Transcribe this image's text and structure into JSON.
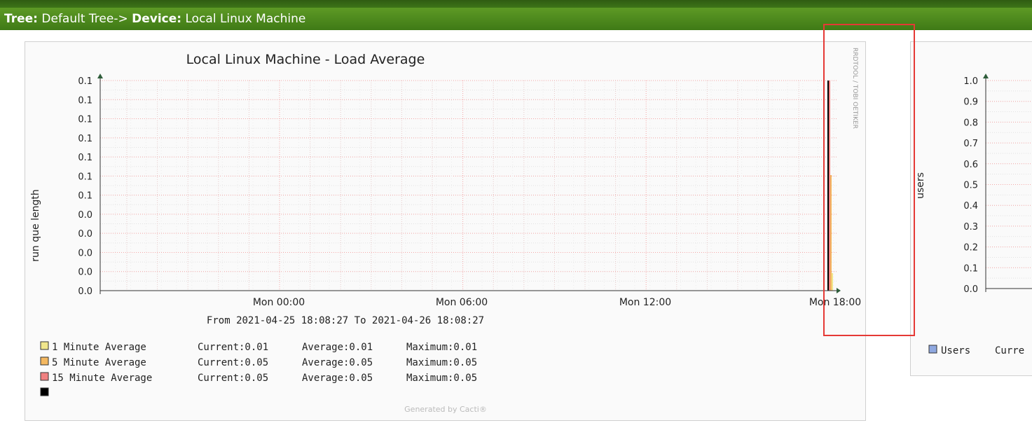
{
  "breadcrumb": {
    "tree_label": "Tree:",
    "tree_value": "Default Tree->",
    "device_label": "Device:",
    "device_value": "Local Linux Machine"
  },
  "graph_left": {
    "title": "Local Linux Machine - Load Average",
    "ylabel": "run que length",
    "watermark": "RRDTOOL / TOBI OETIKER",
    "y_ticks": [
      "0.1",
      "0.1",
      "0.1",
      "0.1",
      "0.1",
      "0.1",
      "0.1",
      "0.0",
      "0.0",
      "0.0",
      "0.0",
      "0.0"
    ],
    "x_ticks": [
      "Mon 00:00",
      "Mon 06:00",
      "Mon 12:00",
      "Mon 18:00"
    ],
    "range_text": "From 2021-04-25 18:08:27 To 2021-04-26 18:08:27",
    "legend": [
      {
        "name": "1 Minute Average",
        "current": "Current:0.01",
        "average": "Average:0.01",
        "maximum": "Maximum:0.01",
        "color": "#f0e68c"
      },
      {
        "name": "5 Minute Average",
        "current": "Current:0.05",
        "average": "Average:0.05",
        "maximum": "Maximum:0.05",
        "color": "#f4b860"
      },
      {
        "name": "15 Minute Average",
        "current": "Current:0.05",
        "average": "Average:0.05",
        "maximum": "Maximum:0.05",
        "color": "#f08080"
      },
      {
        "name": "",
        "current": "",
        "average": "",
        "maximum": "",
        "color": "#000000"
      }
    ],
    "footer": "Generated by Cacti®"
  },
  "graph_right": {
    "ylabel": "users",
    "y_ticks": [
      "1.0",
      "0.9",
      "0.8",
      "0.7",
      "0.6",
      "0.5",
      "0.4",
      "0.3",
      "0.2",
      "0.1",
      "0.0"
    ],
    "legend": [
      {
        "name": "Users",
        "current": "Curre",
        "color": "#8fa8e0"
      }
    ]
  },
  "chart_data": [
    {
      "type": "area",
      "title": "Local Linux Machine - Load Average",
      "xlabel": "",
      "ylabel": "run que length",
      "x_range": [
        "2021-04-25 18:08:27",
        "2021-04-26 18:08:27"
      ],
      "series": [
        {
          "name": "1 Minute Average",
          "current": 0.01,
          "average": 0.01,
          "maximum": 0.01
        },
        {
          "name": "5 Minute Average",
          "current": 0.05,
          "average": 0.05,
          "maximum": 0.05
        },
        {
          "name": "15 Minute Average",
          "current": 0.05,
          "average": 0.05,
          "maximum": 0.05
        }
      ],
      "ylim": [
        0,
        0.1
      ],
      "grid": true
    },
    {
      "type": "area",
      "ylabel": "users",
      "ylim": [
        0,
        1.0
      ],
      "grid": true,
      "series": [
        {
          "name": "Users"
        }
      ]
    }
  ],
  "colors": {
    "header_green": "#4a8a1c",
    "highlight": "#e53935",
    "grid_major": "#f4a6a6",
    "grid_minor": "#dcdcdc"
  }
}
